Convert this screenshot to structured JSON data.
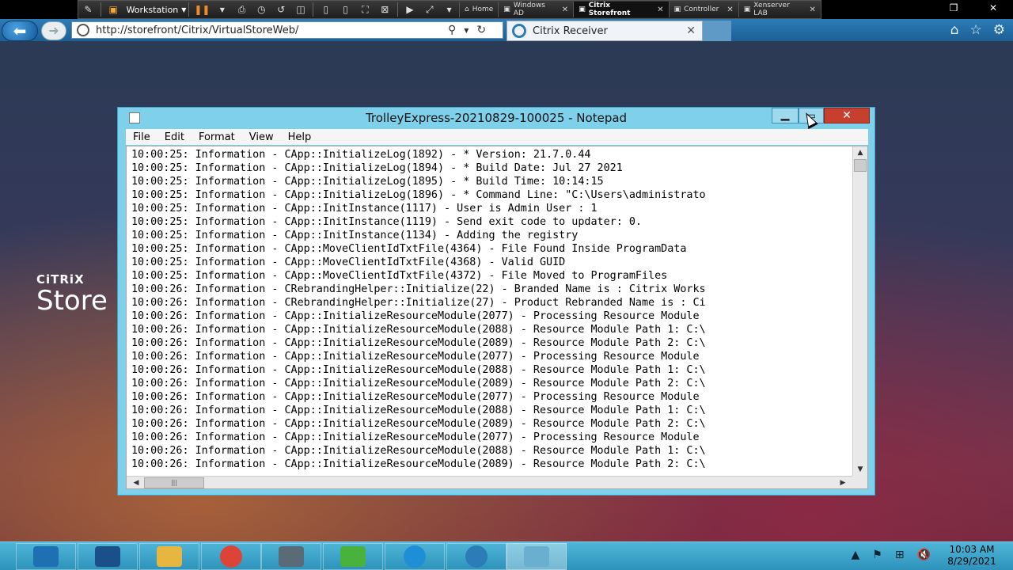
{
  "vm": {
    "workstation_label": "Workstation",
    "tabs": [
      {
        "label": "Home",
        "active": false
      },
      {
        "label": "Windows AD",
        "active": false
      },
      {
        "label": "Citrix Storefront",
        "active": true
      },
      {
        "label": "Controller",
        "active": false
      },
      {
        "label": "Xenserver LAB",
        "active": false
      }
    ]
  },
  "browser": {
    "address": "http://storefront/Citrix/VirtualStoreWeb/",
    "tab_title": "Citrix Receiver"
  },
  "desktop": {
    "citrix_word": "CiTRiX",
    "store_word": "Store"
  },
  "notepad": {
    "title": "TrolleyExpress-20210829-100025 - Notepad",
    "menu": [
      "File",
      "Edit",
      "Format",
      "View",
      "Help"
    ],
    "lines": [
      "10:00:25: Information - CApp::InitializeLog(1892) - * Version: 21.7.0.44",
      "10:00:25: Information - CApp::InitializeLog(1894) - * Build Date: Jul 27 2021",
      "10:00:25: Information - CApp::InitializeLog(1895) - * Build Time: 10:14:15",
      "10:00:25: Information - CApp::InitializeLog(1896) - * Command Line: \"C:\\Users\\administrato",
      "10:00:25: Information - CApp::InitInstance(1117) - User is Admin User : 1",
      "10:00:25: Information - CApp::InitInstance(1119) - Send exit code to updater: 0.",
      "10:00:25: Information - CApp::InitInstance(1134) - Adding the registry",
      "10:00:25: Information - CApp::MoveClientIdTxtFile(4364) - File Found Inside ProgramData",
      "10:00:25: Information - CApp::MoveClientIdTxtFile(4368) - Valid GUID",
      "10:00:25: Information - CApp::MoveClientIdTxtFile(4372) - File Moved to ProgramFiles",
      "10:00:26: Information - CRebrandingHelper::Initialize(22) - Branded Name is : Citrix Works",
      "10:00:26: Information - CRebrandingHelper::Initialize(27) - Product Rebranded Name is : Ci",
      "10:00:26: Information - CApp::InitializeResourceModule(2077) - Processing Resource Module ",
      "10:00:26: Information - CApp::InitializeResourceModule(2088) - Resource Module Path 1: C:\\",
      "10:00:26: Information - CApp::InitializeResourceModule(2089) - Resource Module Path 2: C:\\",
      "10:00:26: Information - CApp::InitializeResourceModule(2077) - Processing Resource Module ",
      "10:00:26: Information - CApp::InitializeResourceModule(2088) - Resource Module Path 1: C:\\",
      "10:00:26: Information - CApp::InitializeResourceModule(2089) - Resource Module Path 2: C:\\",
      "10:00:26: Information - CApp::InitializeResourceModule(2077) - Processing Resource Module ",
      "10:00:26: Information - CApp::InitializeResourceModule(2088) - Resource Module Path 1: C:\\",
      "10:00:26: Information - CApp::InitializeResourceModule(2089) - Resource Module Path 2: C:\\",
      "10:00:26: Information - CApp::InitializeResourceModule(2077) - Processing Resource Module ",
      "10:00:26: Information - CApp::InitializeResourceModule(2088) - Resource Module Path 1: C:\\",
      "10:00:26: Information - CApp::InitializeResourceModule(2089) - Resource Module Path 2: C:\\"
    ]
  },
  "taskbar": {
    "apps": [
      {
        "name": "server-manager",
        "color": "#1f6fb3"
      },
      {
        "name": "powershell",
        "color": "#1b4f8a"
      },
      {
        "name": "file-explorer",
        "color": "#e7b640"
      },
      {
        "name": "chrome",
        "color": "#db4437"
      },
      {
        "name": "citrix-studio",
        "color": "#5a6b78"
      },
      {
        "name": "citrix-director",
        "color": "#49b23c"
      },
      {
        "name": "internet-explorer",
        "color": "#1e8fd6"
      },
      {
        "name": "citrix-receiver",
        "color": "#2c7cb8"
      },
      {
        "name": "notepad",
        "color": "#6aaed0"
      }
    ],
    "clock_time": "10:03 AM",
    "clock_date": "8/29/2021"
  }
}
